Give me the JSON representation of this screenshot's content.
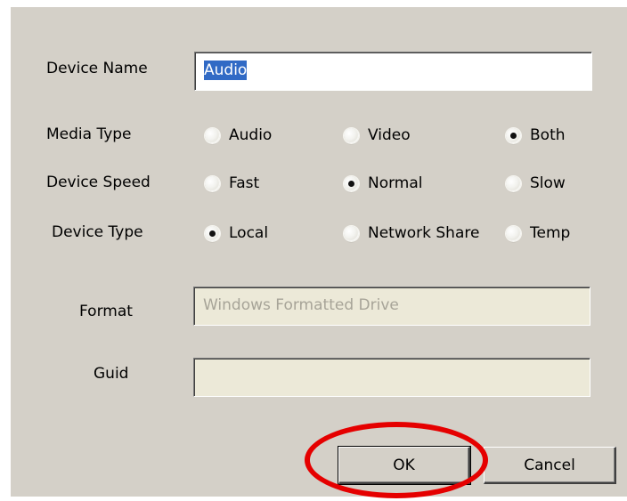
{
  "form": {
    "device_name": {
      "label": "Device Name",
      "value": "Audio"
    },
    "media_type": {
      "label": "Media Type",
      "options": [
        {
          "label": "Audio",
          "checked": false
        },
        {
          "label": "Video",
          "checked": false
        },
        {
          "label": "Both",
          "checked": true
        }
      ]
    },
    "device_speed": {
      "label": "Device Speed",
      "options": [
        {
          "label": "Fast",
          "checked": false
        },
        {
          "label": "Normal",
          "checked": true
        },
        {
          "label": "Slow",
          "checked": false
        }
      ]
    },
    "device_type": {
      "label": "Device Type",
      "options": [
        {
          "label": "Local",
          "checked": true
        },
        {
          "label": "Network Share",
          "checked": false
        },
        {
          "label": "Temp",
          "checked": false
        }
      ]
    },
    "format": {
      "label": "Format",
      "value": "Windows Formatted Drive"
    },
    "guid": {
      "label": "Guid",
      "value": ""
    }
  },
  "buttons": {
    "ok_label": "OK",
    "cancel_label": "Cancel"
  },
  "colors": {
    "dialog_bg": "#d4d0c8",
    "selection": "#316ac5",
    "disabled_field": "#ece9d8",
    "annotation_ring": "#e50000"
  }
}
